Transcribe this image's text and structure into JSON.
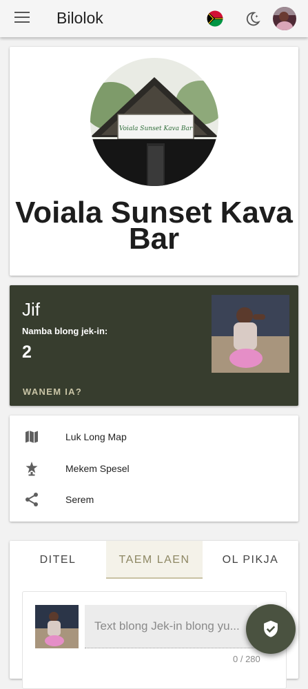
{
  "app": {
    "title": "Bilolok"
  },
  "header": {
    "menu_icon": "menu-icon",
    "language_icon": "vanuatu-flag-icon",
    "theme_icon": "dark-mode-moon-icon",
    "avatar": "user-avatar"
  },
  "venue": {
    "name": "Voiala Sunset Kava Bar",
    "photo_sign_text": "Voiala Sunset Kava Bar"
  },
  "checkin": {
    "title": "Jif",
    "count_label": "Namba blong jek-in:",
    "count": "2",
    "link_label": "WANEM IA?"
  },
  "actions": [
    {
      "label": "Luk Long Map",
      "icon": "map-icon"
    },
    {
      "label": "Mekem Spesel",
      "icon": "featured-star-icon"
    },
    {
      "label": "Serem",
      "icon": "share-icon"
    }
  ],
  "tabs": [
    {
      "label": "DITEL",
      "active": false
    },
    {
      "label": "TAEM LAEN",
      "active": true
    },
    {
      "label": "OL PIKJA",
      "active": false
    }
  ],
  "comment": {
    "placeholder": "Text blong Jek-in blong yu...",
    "counter": "0 / 280"
  },
  "fab": {
    "icon": "checkin-check-icon"
  },
  "colors": {
    "checkin_card": "#373d2e",
    "accent": "#8d8763",
    "fab": "#4a5240"
  }
}
